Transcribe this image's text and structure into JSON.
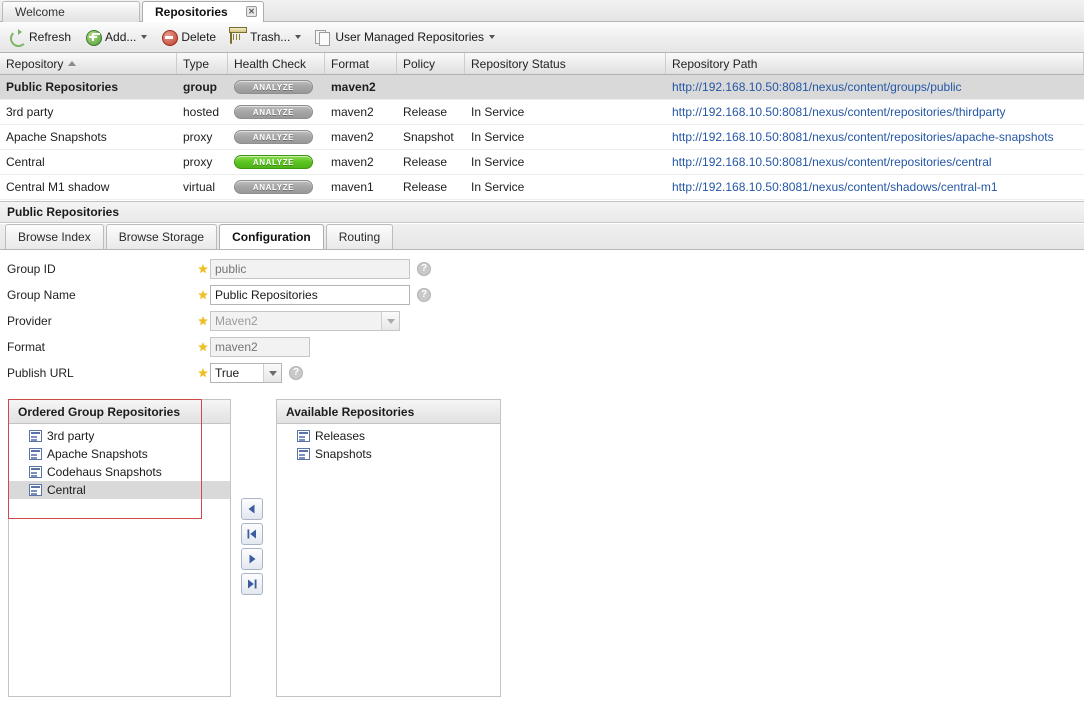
{
  "window_tabs": [
    {
      "label": "Welcome",
      "active": false,
      "closable": false
    },
    {
      "label": "Repositories",
      "active": true,
      "closable": true,
      "close_glyph": "✕"
    }
  ],
  "toolbar": {
    "buttons": [
      {
        "label": "Refresh",
        "icon": "refresh-icon",
        "caret": false
      },
      {
        "label": "Add...",
        "icon": "add-icon",
        "caret": true
      },
      {
        "label": "Delete",
        "icon": "delete-icon",
        "caret": false
      },
      {
        "label": "Trash...",
        "icon": "trash-icon",
        "caret": true
      },
      {
        "label": "User Managed Repositories",
        "icon": "copy-icon",
        "caret": true
      }
    ]
  },
  "grid": {
    "columns": [
      {
        "label": "Repository",
        "sorted": "asc"
      },
      {
        "label": "Type",
        "sorted": ""
      },
      {
        "label": "Health Check",
        "sorted": ""
      },
      {
        "label": "Format",
        "sorted": ""
      },
      {
        "label": "Policy",
        "sorted": ""
      },
      {
        "label": "Repository Status",
        "sorted": ""
      },
      {
        "label": "Repository Path",
        "sorted": ""
      }
    ],
    "rows": [
      {
        "repository": "Public Repositories",
        "type": "group",
        "health": "ANALYZE",
        "health_state": "grey",
        "format": "maven2",
        "policy": "",
        "status": "",
        "path": "http://192.168.10.50:8081/nexus/content/groups/public",
        "selected": true
      },
      {
        "repository": "3rd party",
        "type": "hosted",
        "health": "ANALYZE",
        "health_state": "grey",
        "format": "maven2",
        "policy": "Release",
        "status": "In Service",
        "path": "http://192.168.10.50:8081/nexus/content/repositories/thirdparty",
        "selected": false
      },
      {
        "repository": "Apache Snapshots",
        "type": "proxy",
        "health": "ANALYZE",
        "health_state": "grey",
        "format": "maven2",
        "policy": "Snapshot",
        "status": "In Service",
        "path": "http://192.168.10.50:8081/nexus/content/repositories/apache-snapshots",
        "selected": false
      },
      {
        "repository": "Central",
        "type": "proxy",
        "health": "ANALYZE",
        "health_state": "green",
        "format": "maven2",
        "policy": "Release",
        "status": "In Service",
        "path": "http://192.168.10.50:8081/nexus/content/repositories/central",
        "selected": false
      },
      {
        "repository": "Central M1 shadow",
        "type": "virtual",
        "health": "ANALYZE",
        "health_state": "grey",
        "format": "maven1",
        "policy": "Release",
        "status": "In Service",
        "path": "http://192.168.10.50:8081/nexus/content/shadows/central-m1",
        "selected": false
      }
    ]
  },
  "detail": {
    "title": "Public Repositories",
    "tabs": [
      {
        "label": "Browse Index",
        "active": false
      },
      {
        "label": "Browse Storage",
        "active": false
      },
      {
        "label": "Configuration",
        "active": true
      },
      {
        "label": "Routing",
        "active": false
      }
    ]
  },
  "form": {
    "star_glyph": "★",
    "help_glyph": "?",
    "fields": [
      {
        "label": "Group ID",
        "required": true,
        "control": "input",
        "value": "public",
        "placeholder": "public",
        "disabled": true,
        "help": true,
        "width": "w200"
      },
      {
        "label": "Group Name",
        "required": true,
        "control": "input",
        "value": "Public Repositories",
        "placeholder": "",
        "disabled": false,
        "help": true,
        "width": "w200"
      },
      {
        "label": "Provider",
        "required": true,
        "control": "select",
        "value": "Maven2",
        "disabled": true,
        "help": false,
        "width": "w190"
      },
      {
        "label": "Format",
        "required": true,
        "control": "input",
        "value": "maven2",
        "placeholder": "maven2",
        "disabled": true,
        "help": false,
        "width": "w100"
      },
      {
        "label": "Publish URL",
        "required": true,
        "control": "select",
        "value": "True",
        "disabled": false,
        "help": true,
        "width": "w72"
      }
    ]
  },
  "ordered_group": {
    "title": "Ordered Group Repositories",
    "items": [
      {
        "label": "3rd party",
        "selected": false
      },
      {
        "label": "Apache Snapshots",
        "selected": false
      },
      {
        "label": "Codehaus Snapshots",
        "selected": false
      },
      {
        "label": "Central",
        "selected": true
      }
    ]
  },
  "available": {
    "title": "Available Repositories",
    "items": [
      {
        "label": "Releases",
        "selected": false
      },
      {
        "label": "Snapshots",
        "selected": false
      }
    ]
  },
  "transfer_buttons": [
    {
      "name": "move-left-button",
      "glyph": "◀"
    },
    {
      "name": "move-all-left-button",
      "glyph": "⏮"
    },
    {
      "name": "move-right-button",
      "glyph": "▶"
    },
    {
      "name": "move-all-right-button",
      "glyph": "⏭"
    }
  ],
  "colors": {
    "accent_link": "#2457a5",
    "health_green": "#5cc421",
    "health_grey": "#a5a5a5",
    "highlight_box": "#cf4a46",
    "row_selected": "#d9d9d9",
    "required_star": "#f0c020"
  }
}
